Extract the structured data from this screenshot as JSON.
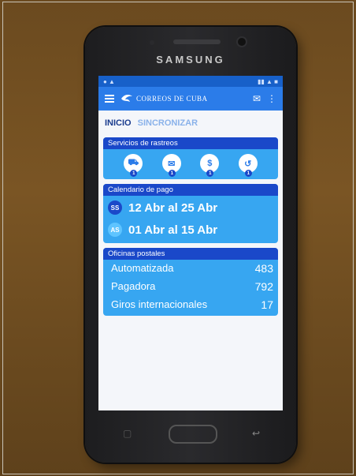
{
  "phone": {
    "brand": "SAMSUNG"
  },
  "app": {
    "title": "CORREOS DE CUBA",
    "tabs": [
      {
        "label": "INICIO",
        "active": true
      },
      {
        "label": "SINCRONIZAR",
        "active": false
      }
    ],
    "tracking": {
      "title": "Servicios de rastreos",
      "items": [
        {
          "icon": "delivery-truck-icon",
          "badge": "1"
        },
        {
          "icon": "envelope-icon",
          "badge": "1"
        },
        {
          "icon": "money-transfer-icon",
          "badge": "1"
        },
        {
          "icon": "money-return-icon",
          "badge": "1"
        }
      ]
    },
    "calendar": {
      "title": "Calendario de pago",
      "rows": [
        {
          "badge": "SS",
          "range": "12 Abr al 25 Abr"
        },
        {
          "badge": "AS",
          "range": "01 Abr al 15 Abr"
        }
      ]
    },
    "offices": {
      "title": "Oficinas postales",
      "rows": [
        {
          "label": "Automatizada",
          "value": "483"
        },
        {
          "label": "Pagadora",
          "value": "792"
        },
        {
          "label": "Giros internacionales",
          "value": "17"
        }
      ]
    }
  },
  "colors": {
    "appbar": "#2b7ce9",
    "card": "#37a6f1",
    "card_title": "#1a48c9"
  }
}
